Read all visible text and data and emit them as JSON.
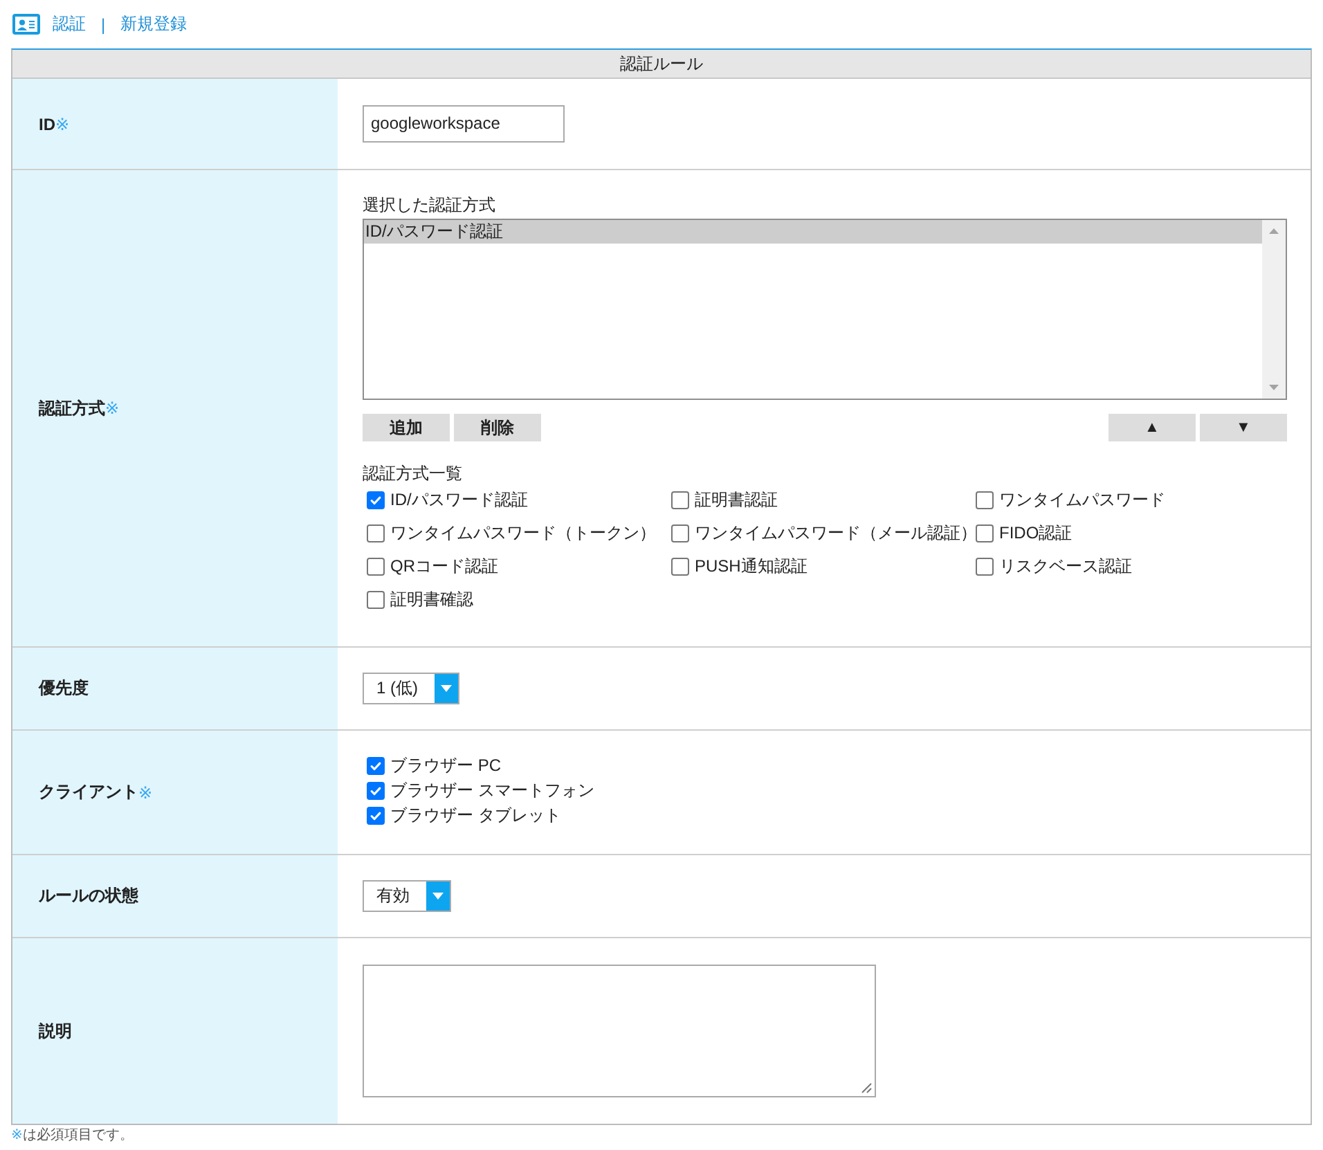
{
  "header": {
    "breadcrumbs": [
      {
        "label": "認証"
      },
      {
        "label": "新規登録"
      }
    ],
    "separator": "|"
  },
  "form": {
    "title": "認証ルール",
    "rows": [
      {
        "kind": "text",
        "label": "ID",
        "required_mark": "※",
        "value": "googleworkspace"
      },
      {
        "kind": "methods",
        "label": "認証方式",
        "required_mark": "※",
        "selected_caption": "選択した認証方式",
        "selected_items": [
          {
            "label": "ID/パスワード認証",
            "selected": true
          }
        ],
        "list_buttons": [
          {
            "label": "追加"
          },
          {
            "label": "削除"
          }
        ],
        "order_buttons": [
          {
            "label": "▲"
          },
          {
            "label": "▼"
          }
        ],
        "list_caption": "認証方式一覧",
        "options": [
          {
            "label": "ID/パスワード認証",
            "checked": true
          },
          {
            "label": "証明書認証",
            "checked": false
          },
          {
            "label": "ワンタイムパスワード",
            "checked": false
          },
          {
            "label": "ワンタイムパスワード（トークン）",
            "checked": false
          },
          {
            "label": "ワンタイムパスワード（メール認証）",
            "checked": false
          },
          {
            "label": "FIDO認証",
            "checked": false
          },
          {
            "label": "QRコード認証",
            "checked": false
          },
          {
            "label": "PUSH通知認証",
            "checked": false
          },
          {
            "label": "リスクベース認証",
            "checked": false
          },
          {
            "label": "証明書確認",
            "checked": false
          }
        ]
      },
      {
        "kind": "select",
        "label": "優先度",
        "value": "1 (低)"
      },
      {
        "kind": "checks",
        "label": "クライアント",
        "required_mark": "※",
        "options": [
          {
            "label": "ブラウザー PC",
            "checked": true
          },
          {
            "label": "ブラウザー スマートフォン",
            "checked": true
          },
          {
            "label": "ブラウザー タブレット",
            "checked": true
          }
        ]
      },
      {
        "kind": "select",
        "label": "ルールの状態",
        "value": "有効"
      },
      {
        "kind": "textarea",
        "label": "説明"
      }
    ]
  },
  "footnote": {
    "mark": "※",
    "text": "は必須項目です。"
  }
}
